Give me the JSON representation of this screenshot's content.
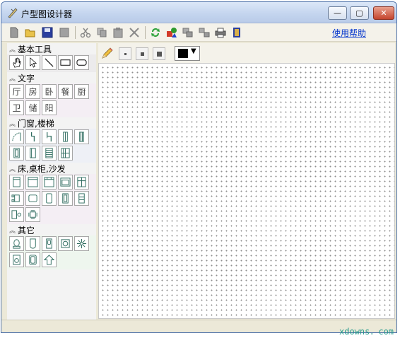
{
  "window": {
    "title": "户型图设计器",
    "min_glyph": "—",
    "max_glyph": "▢",
    "close_glyph": "✕"
  },
  "toolbar": {
    "help_link": "使用帮助"
  },
  "palette": {
    "basic_tools": {
      "label": "基本工具"
    },
    "text": {
      "label": "文字",
      "items": [
        "厅",
        "房",
        "卧",
        "餐",
        "厨",
        "卫",
        "储",
        "阳"
      ]
    },
    "doors_stairs": {
      "label": "门窗,楼梯"
    },
    "furniture": {
      "label": "床,桌柜,沙发"
    },
    "other": {
      "label": "其它"
    }
  },
  "props": {
    "current_color": "#000000"
  },
  "watermark": "xdowns．com",
  "colors": {
    "accent": "#0033cc",
    "canvas": "#ffffff",
    "dots": "#8f8f8f",
    "tool_ink": "#2d6b5e"
  }
}
